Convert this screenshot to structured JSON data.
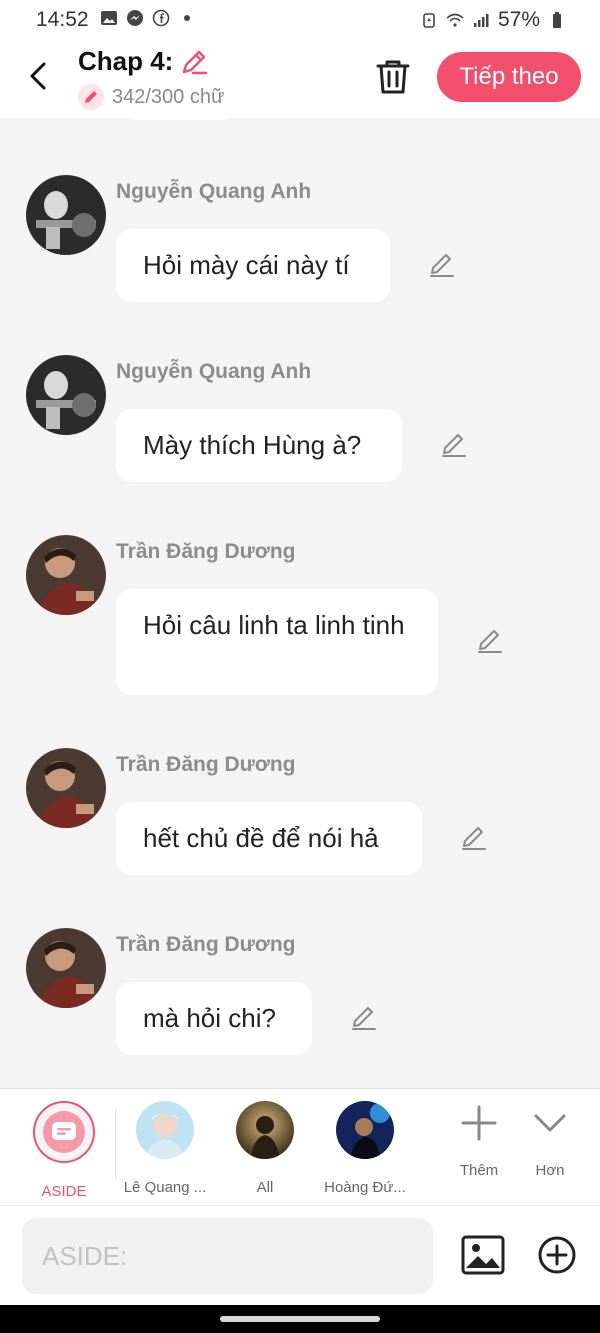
{
  "status_bar": {
    "time": "14:52",
    "battery": "57%",
    "icons": [
      "image-icon",
      "messenger-icon",
      "facebook-icon",
      "dot-icon",
      "alarm-icon",
      "wifi-icon",
      "signal-icon",
      "battery-icon"
    ]
  },
  "header": {
    "title": "Chap 4:",
    "word_count": "342/300 chữ",
    "next_label": "Tiếp theo",
    "accent_color": "#f24f6c"
  },
  "messages": [
    {
      "sender": "Nguyễn Quang Anh",
      "text": "Hỏi mày cái này tí"
    },
    {
      "sender": "Nguyễn Quang Anh",
      "text": "Mày thích Hùng à?"
    },
    {
      "sender": "Trần Đăng Dương",
      "text": "Hỏi câu linh ta linh tinh"
    },
    {
      "sender": "Trần Đăng Dương",
      "text": "hết chủ đề để nói hả"
    },
    {
      "sender": "Trần Đăng Dương",
      "text": "mà hỏi chi?"
    }
  ],
  "characters": [
    {
      "label": "ASIDE"
    },
    {
      "label": "Lê Quang ..."
    },
    {
      "label": "All"
    },
    {
      "label": "Hoàng Đứ..."
    }
  ],
  "tools": {
    "add_label": "Thêm",
    "more_label": "Hơn"
  },
  "composer": {
    "placeholder": "ASIDE:"
  }
}
